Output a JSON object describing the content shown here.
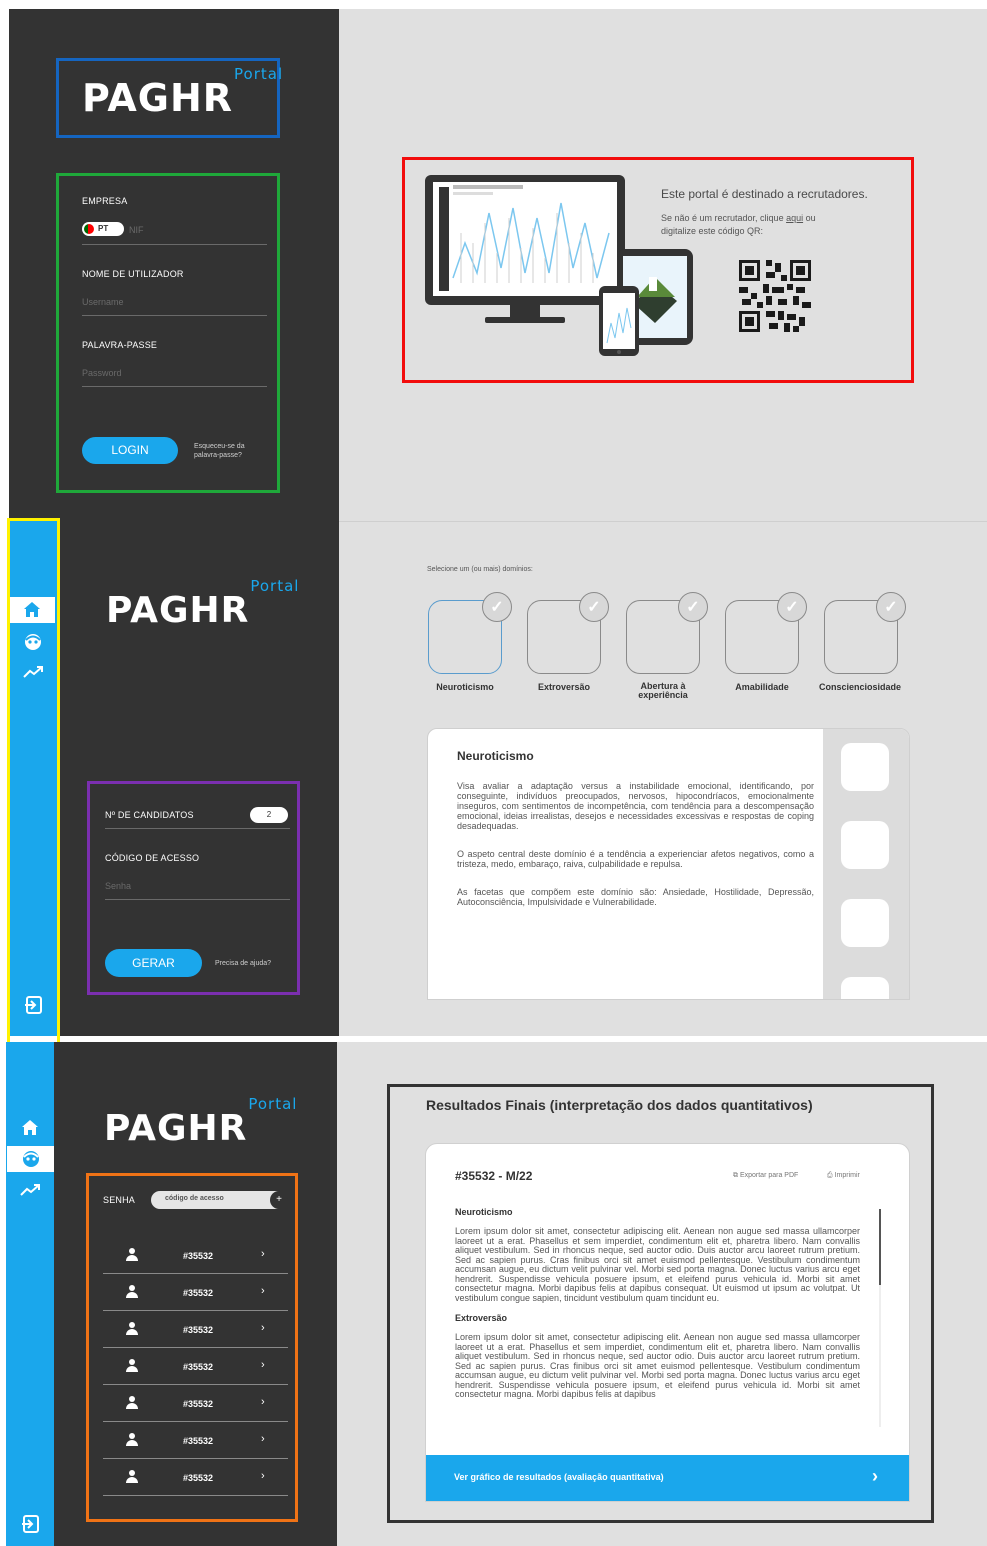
{
  "logo": {
    "brand": "PAGHR",
    "sup": "Portal"
  },
  "login": {
    "company_label": "EMPRESA",
    "country_code": "PT",
    "nif_placeholder": "NIF",
    "username_label": "NOME DE UTILIZADOR",
    "username_placeholder": "Username",
    "password_label": "PALAVRA-PASSE",
    "password_placeholder": "Password",
    "login_button": "LOGIN",
    "forgot_line1": "Esqueceu-se da",
    "forgot_line2": "palavra-passe?"
  },
  "recruiter": {
    "title": "Este portal é destinado a recrutadores.",
    "line1_pre": "Se não é um recrutador, clique ",
    "link": "aqui",
    "line1_post": " ou",
    "line2": "digitalize este código QR:"
  },
  "sidebar": {
    "home_icon": "home-icon",
    "face_icon": "face-icon",
    "trend_icon": "trend-icon",
    "logout_icon": "logout-icon"
  },
  "generate": {
    "candidates_label": "Nº DE CANDIDATOS",
    "candidates_value": "2",
    "code_label": "CÓDIGO DE ACESSO",
    "code_placeholder": "Senha",
    "generate_button": "GERAR",
    "help_link": "Precisa de ajuda?"
  },
  "domains": {
    "instruction": "Selecione um (ou mais) domínios:",
    "items": [
      "Neuroticismo",
      "Extroversão",
      "Abertura à experiência",
      "Amabilidade",
      "Conscienciosidade"
    ],
    "items_line1": [
      "Neuroticismo",
      "Extroversão",
      "Abertura à",
      "Amabilidade",
      "Conscienciosidade"
    ],
    "items_line2": [
      "",
      "",
      "experiência",
      "",
      ""
    ],
    "detail": {
      "title": "Neuroticismo",
      "p1": "Visa avaliar a adaptação versus a instabilidade emocional, identificando, por conseguinte, indivíduos preocupados, nervosos, hipocondríacos, emocionalmente inseguros, com sentimentos de incompetência, com tendência para a descompensação emocional, ideias irrealistas, desejos e necessidades excessivas e respostas de coping desadequadas.",
      "p2": "O aspeto central deste domínio é a tendência a experienciar afetos negativos, como a tristeza, medo, embaraço, raiva, culpabilidade e repulsa.",
      "p3": "As facetas que compõem este domínio são: Ansiedade, Hostilidade, Depressão, Autoconsciência, Impulsividade e Vulnerabilidade."
    }
  },
  "candidates": {
    "senha_label": "SENHA",
    "code_placeholder": "código de acesso",
    "add_symbol": "+",
    "rows": [
      "#35532",
      "#35532",
      "#35532",
      "#35532",
      "#35532",
      "#35532",
      "#35532"
    ]
  },
  "results": {
    "heading": "Resultados Finais (interpretação dos dados quantitativos)",
    "id": "#35532 - M/22",
    "export": "Exportar para PDF",
    "print": "Imprimir",
    "section1_title": "Neuroticismo",
    "section1_text": "Lorem ipsum dolor sit amet, consectetur adipiscing elit. Aenean non augue sed massa ullamcorper laoreet ut a erat. Phasellus et sem imperdiet, condimentum elit et, pharetra libero. Nam convallis aliquet vestibulum. Sed in rhoncus neque, sed auctor odio. Duis auctor arcu laoreet rutrum pretium. Sed ac sapien purus. Cras finibus orci sit amet euismod pellentesque. Vestibulum condimentum accumsan augue, eu dictum velit pulvinar vel. Morbi sed porta magna. Donec luctus varius arcu eget hendrerit. Suspendisse vehicula posuere ipsum, et eleifend purus vehicula id. Morbi sit amet consectetur magna. Morbi dapibus felis at dapibus consequat. Ut euismod ut ipsum ac volutpat. Ut vestibulum congue sapien, tincidunt vestibulum quam tincidunt eu.",
    "section2_title": "Extroversão",
    "section2_text": "Lorem ipsum dolor sit amet, consectetur adipiscing elit. Aenean non augue sed massa ullamcorper laoreet ut a erat. Phasellus et sem imperdiet, condimentum elit et, pharetra libero. Nam convallis aliquet vestibulum. Sed in rhoncus neque, sed auctor odio. Duis auctor arcu laoreet rutrum pretium. Sed ac sapien purus. Cras finibus orci sit amet euismod pellentesque. Vestibulum condimentum accumsan augue, eu dictum velit pulvinar vel. Morbi sed porta magna. Donec luctus varius arcu eget hendrerit. Suspendisse vehicula posuere ipsum, et eleifend purus vehicula id. Morbi sit amet consectetur magna. Morbi dapibus felis at dapibus",
    "cta": "Ver gráfico de resultados (avaliação quantitativa)",
    "cta_arrow": "›"
  },
  "colors": {
    "accent_blue": "#1aa7ec",
    "panel_dark": "#333333",
    "canvas_grey": "#e0e0e0",
    "frame_blue": "#1565c0",
    "frame_green": "#1fa83a",
    "frame_red": "#f20d0d",
    "frame_yellow": "#fff200",
    "frame_purple": "#7b2fb0",
    "frame_orange": "#f07316",
    "frame_dark": "#333333"
  }
}
